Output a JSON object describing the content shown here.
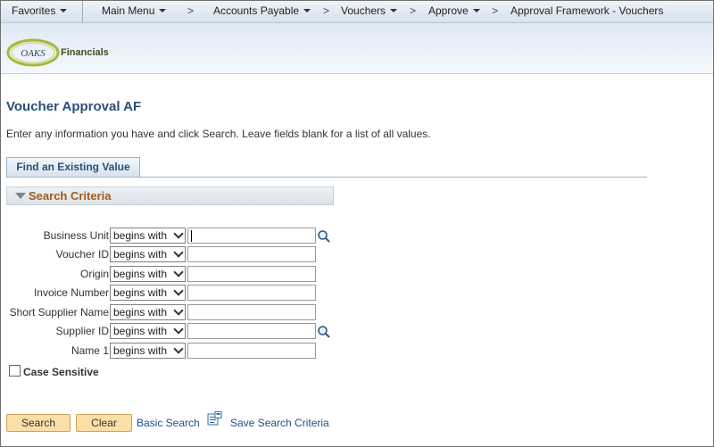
{
  "nav": {
    "favorites": "Favorites",
    "main_menu": "Main Menu",
    "accounts_payable": "Accounts Payable",
    "vouchers": "Vouchers",
    "approve": "Approve",
    "current": "Approval Framework - Vouchers",
    "separator": ">"
  },
  "header": {
    "logo_text": "OAKS",
    "brand": "Financials"
  },
  "page": {
    "title": "Voucher Approval AF",
    "instructions": "Enter any information you have and click Search. Leave fields blank for a list of all values."
  },
  "tab": {
    "label": "Find an Existing Value"
  },
  "criteria": {
    "title": "Search Criteria",
    "rows": [
      {
        "label": "Business Unit",
        "operator": "begins with",
        "value": "",
        "lookup": true
      },
      {
        "label": "Voucher ID",
        "operator": "begins with",
        "value": "",
        "lookup": false
      },
      {
        "label": "Origin",
        "operator": "begins with",
        "value": "",
        "lookup": false
      },
      {
        "label": "Invoice Number",
        "operator": "begins with",
        "value": "",
        "lookup": false
      },
      {
        "label": "Short Supplier Name",
        "operator": "begins with",
        "value": "",
        "lookup": false
      },
      {
        "label": "Supplier ID",
        "operator": "begins with",
        "value": "",
        "lookup": true
      },
      {
        "label": "Name 1",
        "operator": "begins with",
        "value": "",
        "lookup": false
      }
    ],
    "case_sensitive_label": "Case Sensitive",
    "case_sensitive_checked": false
  },
  "actions": {
    "search": "Search",
    "clear": "Clear",
    "basic_search": "Basic Search",
    "save_criteria": "Save Search Criteria"
  },
  "colors": {
    "title": "#2a4f7b",
    "criteria_title": "#a15b19",
    "button": "#fcdfa6",
    "link": "#1b4f8b"
  },
  "icons": {
    "lookup": "magnifier-icon",
    "save": "save-criteria-icon"
  }
}
